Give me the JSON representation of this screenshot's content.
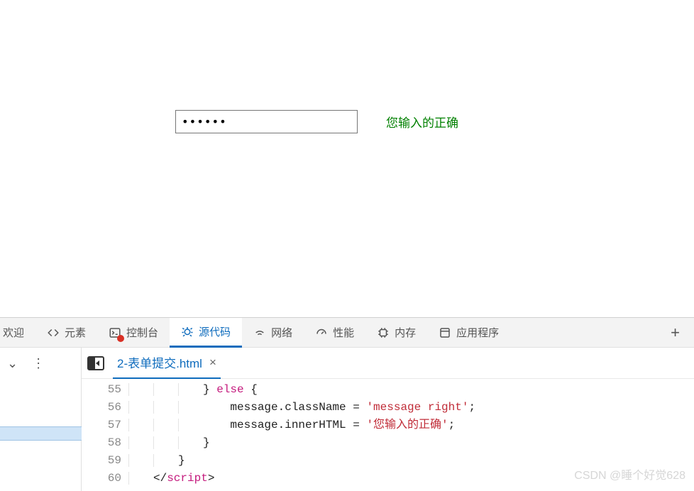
{
  "form": {
    "password_value": "••••••",
    "validation_message": "您输入的正确"
  },
  "devtools": {
    "tabs": {
      "welcome_partial": "欢迎",
      "elements": "元素",
      "console": "控制台",
      "sources": "源代码",
      "network": "网络",
      "performance": "性能",
      "memory": "内存",
      "application": "应用程序"
    },
    "add_icon": "+",
    "file_tab": {
      "name": "2-表单提交.html",
      "close": "×"
    },
    "chevron": "⌄",
    "kebab": "⋮"
  },
  "code": {
    "lines": [
      {
        "num": "55",
        "indent": 3,
        "html": "} <span class='kw'>else</span> {"
      },
      {
        "num": "56",
        "indent": 3,
        "html": "    message.className = <span class='str'>'message right'</span>;"
      },
      {
        "num": "57",
        "indent": 3,
        "html": "    message.innerHTML = <span class='str'>'您输入的正确'</span>;"
      },
      {
        "num": "58",
        "indent": 3,
        "html": "}"
      },
      {
        "num": "59",
        "indent": 2,
        "html": "}"
      },
      {
        "num": "60",
        "indent": 1,
        "html": "&lt;/<span class='tag'>script</span>&gt;"
      }
    ]
  },
  "watermark": "CSDN @睡个好觉628"
}
